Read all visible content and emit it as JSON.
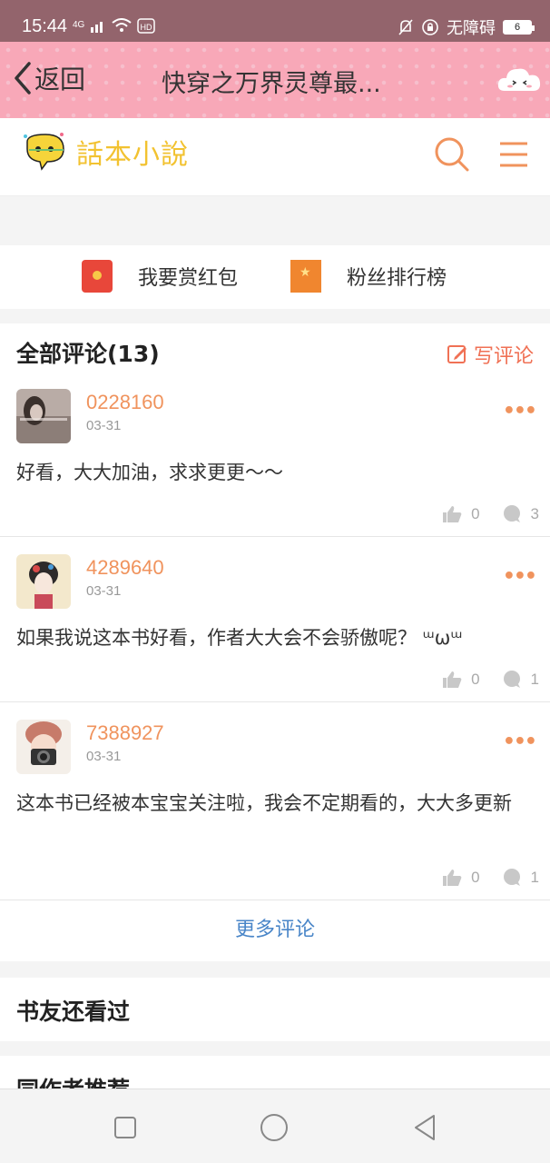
{
  "status_bar": {
    "time": "15:44",
    "network": "4G",
    "accessibility_label": "无障碍",
    "battery": "6"
  },
  "nav": {
    "back_label": "返回",
    "title": "快穿之万界灵尊最..."
  },
  "header": {
    "logo_text": "話本小說"
  },
  "actions": {
    "reward_label": "我要赏红包",
    "fans_label": "粉丝排行榜"
  },
  "comments": {
    "heading": "全部评论(13)",
    "write_label": "写评论",
    "items": [
      {
        "user": "0228160",
        "date": "03-31",
        "text": "好看，大大加油，求求更更～～",
        "likes": "0",
        "replies": "3"
      },
      {
        "user": "4289640",
        "date": "03-31",
        "text": "如果我说这本书好看，作者大大会不会骄傲呢？ ᵚωᵚ",
        "likes": "0",
        "replies": "1"
      },
      {
        "user": "7388927",
        "date": "03-31",
        "text": "这本书已经被本宝宝关注啦，我会不定期看的，大大多更新",
        "likes": "0",
        "replies": "1"
      }
    ],
    "more_label": "更多评论"
  },
  "sections": {
    "also_read": "书友还看过",
    "same_author": "同作者推荐"
  },
  "colors": {
    "nav_pink": "#f8a8b8",
    "accent_orange": "#f0935d",
    "link_blue": "#4a86c8"
  }
}
